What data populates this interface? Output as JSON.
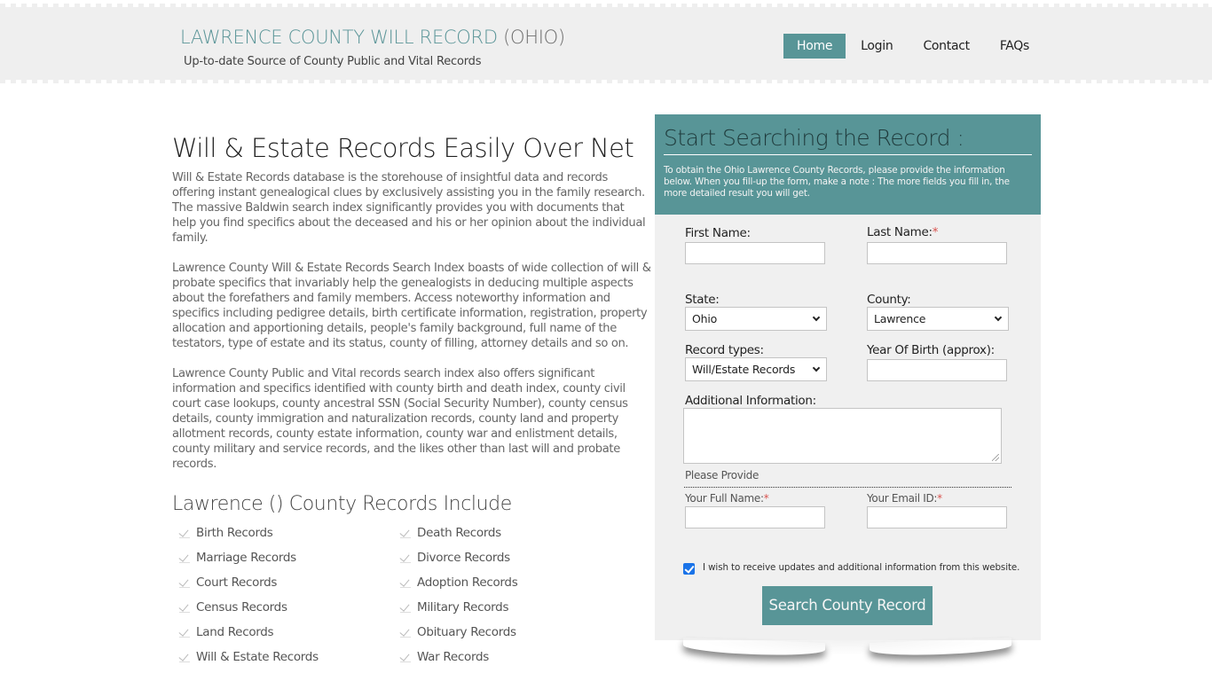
{
  "header": {
    "site_title": "LAWRENCE COUNTY WILL RECORD",
    "site_title_state": "(OHIO)",
    "subtitle": "Up-to-date Source of  County Public and Vital Records",
    "nav": [
      {
        "label": "Home",
        "active": true
      },
      {
        "label": "Login",
        "active": false
      },
      {
        "label": "Contact",
        "active": false
      },
      {
        "label": "FAQs",
        "active": false
      }
    ]
  },
  "main": {
    "heading": "Will & Estate Records Easily Over Net",
    "paragraphs": [
      "Will & Estate Records database is the storehouse of insightful data and records offering instant genealogical clues by exclusively assisting you in the family research. The massive Baldwin search index significantly provides you with documents that help you find specifics about the deceased and his or her opinion about the individual family.",
      "Lawrence County Will & Estate Records Search Index boasts of wide collection of will & probate specifics that invariably help the genealogists in deducing multiple aspects about the forefathers and family members. Access noteworthy information and specifics including pedigree details, birth certificate information, registration, property allocation and apportioning details, people's family background, full name of the testators, type of estate and its status, county of filling, attorney details and so on.",
      "Lawrence County Public and Vital records search index also offers significant information and specifics identified with county birth and death index, county civil court case lookups, county ancestral SSN (Social Security Number), county census details, county immigration and naturalization records, county land and property allotment records, county estate information, county war and enlistment details, county military and service records, and the likes other than last will and probate records."
    ],
    "records_heading": "Lawrence () County Records Include",
    "records": [
      "Birth Records",
      "Death Records",
      "Marriage Records",
      "Divorce Records",
      "Court Records",
      "Adoption Records",
      "Census Records",
      "Military Records",
      "Land Records",
      "Obituary Records",
      "Will & Estate Records",
      "War Records"
    ]
  },
  "form": {
    "title": "Start Searching the Record :",
    "intro": "To obtain the Ohio Lawrence County Records, please provide the information below. When you fill-up the form, make a note : The more fields you fill in, the more detailed result you will get.",
    "first_name_label": "First Name:",
    "first_name_value": "",
    "last_name_label": "Last Name:",
    "required_mark": "*",
    "last_name_value": "",
    "state_label": "State:",
    "state_value": "Ohio",
    "county_label": "County:",
    "county_value": "Lawrence",
    "record_types_label": "Record types:",
    "record_types_value": "Will/Estate Records",
    "yob_label": "Year Of Birth (approx):",
    "yob_value": "",
    "additional_label": "Additional Information:",
    "additional_value": "",
    "please_provide": "Please Provide",
    "full_name_label": "Your Full Name:",
    "full_name_value": "",
    "email_label": "Your Email ID:",
    "email_value": "",
    "updates_checked": true,
    "updates_label": "I wish to receive updates and additional information from this website.",
    "submit_label": "Search County Record"
  },
  "colors": {
    "accent": "#589597",
    "header_bg": "#efefef",
    "panel_bg": "#f0f0f0",
    "required": "#d9534f",
    "checkbox": "#1a73e8"
  }
}
